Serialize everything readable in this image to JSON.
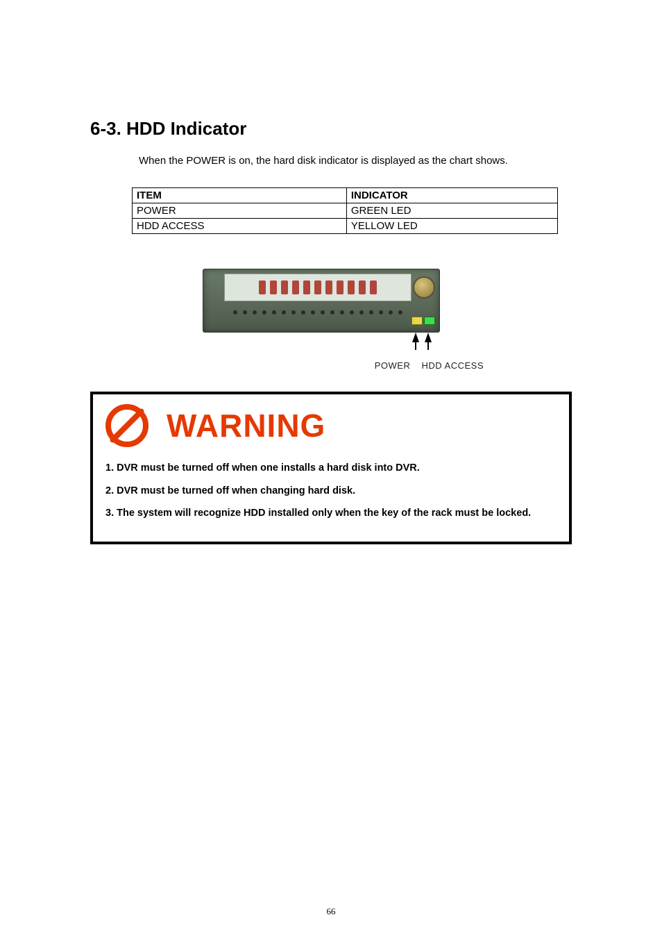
{
  "section": {
    "title": "6-3. HDD Indicator"
  },
  "intro": "When the POWER is on, the hard disk indicator is displayed as the chart shows.",
  "table": {
    "headers": {
      "c1": "ITEM",
      "c2": "INDICATOR"
    },
    "rows": [
      {
        "c1": "POWER",
        "c2": "GREEN LED"
      },
      {
        "c1": "HDD ACCESS",
        "c2": "YELLOW LED"
      }
    ]
  },
  "photo_labels": {
    "l1": "POWER",
    "l2": "HDD ACCESS"
  },
  "warning": {
    "title": "WARNING",
    "lines": [
      "1. DVR must be turned off when one installs a hard disk into DVR.",
      "2. DVR must be turned off when changing hard disk.",
      "3. The system will recognize HDD installed only when the key of the rack must be locked."
    ]
  },
  "page_number": "66"
}
